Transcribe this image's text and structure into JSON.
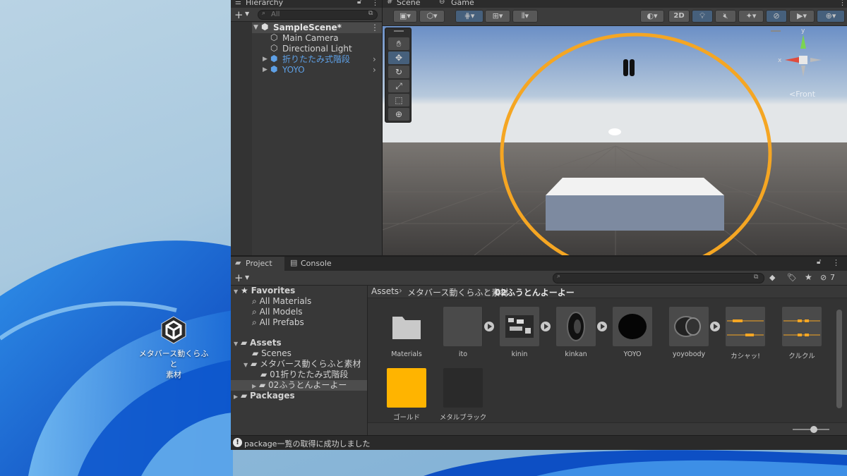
{
  "desktop": {
    "icon_label_line1": "メタバース動くらふと",
    "icon_label_line2": "素材"
  },
  "hierarchy": {
    "tab_label": "Hierarchy",
    "search_placeholder": "All",
    "scene_name": "SampleScene*",
    "items": [
      {
        "label": "Main Camera"
      },
      {
        "label": "Directional Light"
      },
      {
        "label": "折りたたみ式階段"
      },
      {
        "label": "YOYO"
      }
    ]
  },
  "scene": {
    "tab_scene": "Scene",
    "tab_game": "Game",
    "mode_2d": "2D",
    "gizmo_front": "<Front",
    "axis_y": "y",
    "axis_x": "x"
  },
  "project": {
    "tab_project": "Project",
    "tab_console": "Console",
    "hidden_count": "7",
    "breadcrumb": [
      "Assets",
      "メタバース動くらふと素材",
      "02ふうとんよーよー"
    ],
    "favorites": {
      "label": "Favorites",
      "items": [
        "All Materials",
        "All Models",
        "All Prefabs"
      ]
    },
    "assets_tree": {
      "label": "Assets",
      "scenes": "Scenes",
      "folder": "メタバース動くらふと素材",
      "sub1": "01折りたたみ式階段",
      "sub2": "02ふうとんよーよー",
      "packages": "Packages"
    },
    "assets": [
      {
        "name": "Materials",
        "kind": "folder"
      },
      {
        "name": "ito",
        "kind": "model"
      },
      {
        "name": "kinin",
        "kind": "model"
      },
      {
        "name": "kinkan",
        "kind": "model"
      },
      {
        "name": "YOYO",
        "kind": "prefab"
      },
      {
        "name": "yoyobody",
        "kind": "model"
      },
      {
        "name": "カシャッ!",
        "kind": "audio"
      },
      {
        "name": "クルクル",
        "kind": "audio"
      },
      {
        "name": "ゴールド",
        "kind": "material",
        "color": "#ffb400"
      },
      {
        "name": "メタルブラック",
        "kind": "material",
        "color": "#2a2a2a"
      }
    ]
  },
  "status_bar": {
    "message": "package一覧の取得に成功しました"
  },
  "colors": {
    "accent_blue": "#46607c",
    "gold": "#f5a623",
    "panel": "#383838",
    "panel_dark": "#282828"
  }
}
